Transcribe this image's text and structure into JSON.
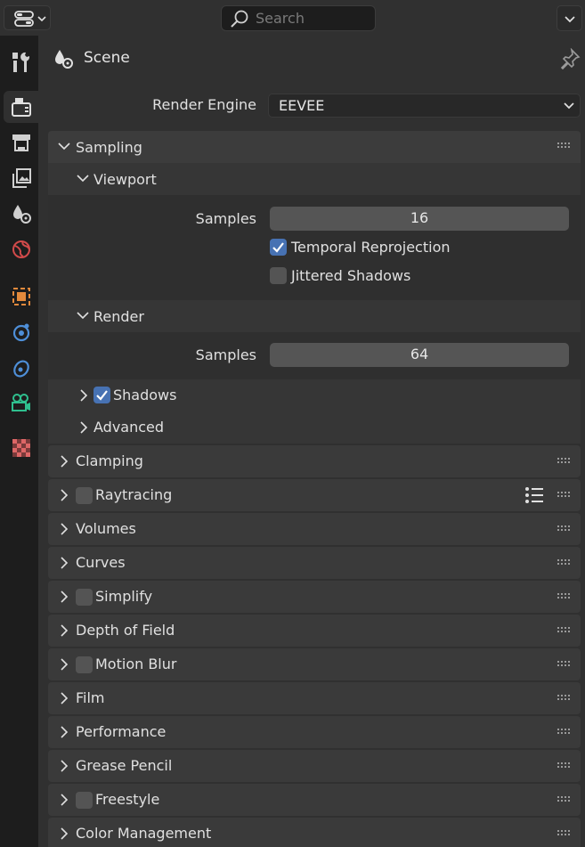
{
  "header": {
    "search_placeholder": "Search"
  },
  "breadcrumb": {
    "label": "Scene"
  },
  "render_engine": {
    "label": "Render Engine",
    "value": "EEVEE"
  },
  "sampling": {
    "label": "Sampling",
    "viewport": {
      "label": "Viewport",
      "samples_label": "Samples",
      "samples_value": "16",
      "temporal_reprojection": {
        "label": "Temporal Reprojection",
        "checked": true
      },
      "jittered_shadows": {
        "label": "Jittered Shadows",
        "checked": false
      }
    },
    "render": {
      "label": "Render",
      "samples_label": "Samples",
      "samples_value": "64"
    },
    "shadows": {
      "label": "Shadows",
      "checked": true
    },
    "advanced": {
      "label": "Advanced"
    }
  },
  "panels": [
    {
      "label": "Clamping",
      "has_checkbox": false
    },
    {
      "label": "Raytracing",
      "has_checkbox": true
    },
    {
      "label": "Volumes",
      "has_checkbox": false
    },
    {
      "label": "Curves",
      "has_checkbox": false
    },
    {
      "label": "Simplify",
      "has_checkbox": true
    },
    {
      "label": "Depth of Field",
      "has_checkbox": false
    },
    {
      "label": "Motion Blur",
      "has_checkbox": true
    },
    {
      "label": "Film",
      "has_checkbox": false
    },
    {
      "label": "Performance",
      "has_checkbox": false
    },
    {
      "label": "Grease Pencil",
      "has_checkbox": false
    },
    {
      "label": "Freestyle",
      "has_checkbox": true
    },
    {
      "label": "Color Management",
      "has_checkbox": false
    }
  ],
  "colors": {
    "accent": "#4772b3",
    "tool_orange": "#e38a3c",
    "physics_blue": "#4e8fd8",
    "camera_green": "#2fbf8e",
    "world_red": "#d14a4a"
  }
}
